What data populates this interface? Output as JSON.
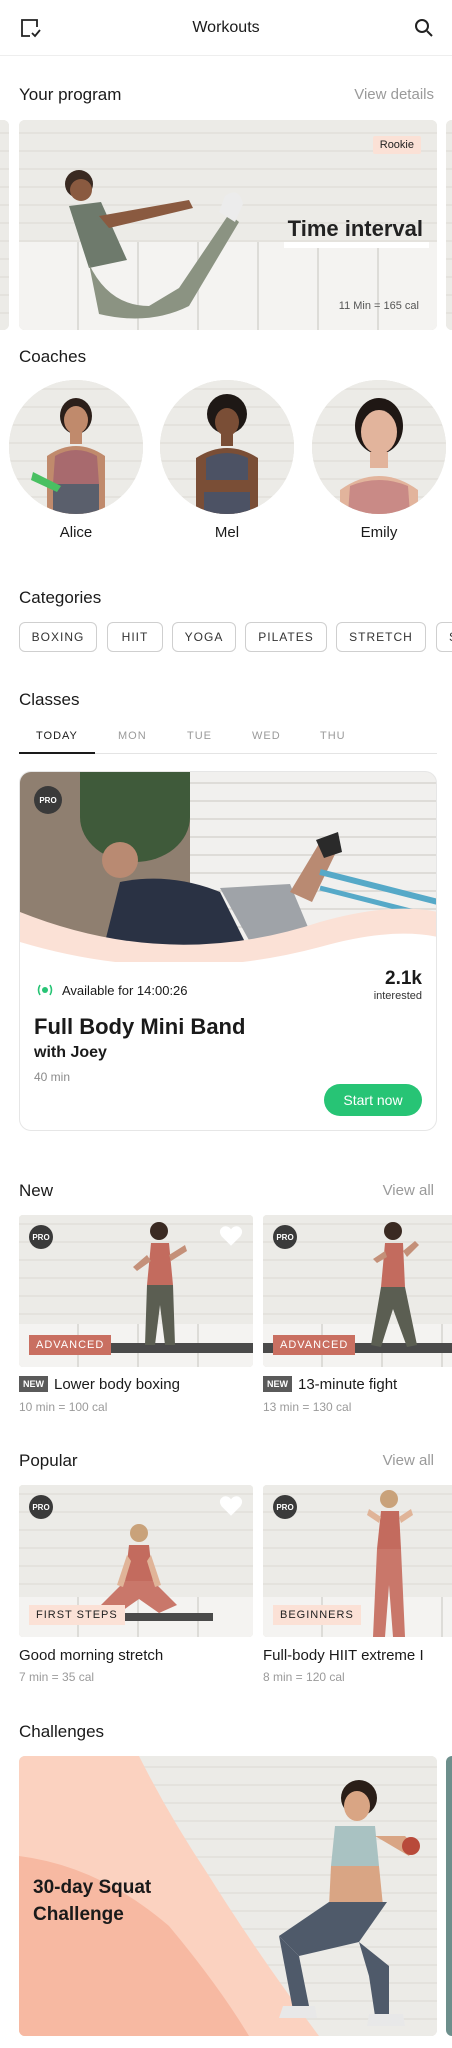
{
  "header": {
    "title": "Workouts"
  },
  "program": {
    "heading": "Your program",
    "view_details": "View details",
    "badge": "Rookie",
    "title": "Time interval",
    "meta": "11 Min = 165 cal"
  },
  "coaches": {
    "heading": "Coaches",
    "items": [
      {
        "name": "Alice"
      },
      {
        "name": "Mel"
      },
      {
        "name": "Emily"
      }
    ]
  },
  "categories": {
    "heading": "Categories",
    "items": [
      "BOXING",
      "HIIT",
      "YOGA",
      "PILATES",
      "STRETCH",
      "S"
    ]
  },
  "classes": {
    "heading": "Classes",
    "tabs": [
      "TODAY",
      "MON",
      "TUE",
      "WED",
      "THU"
    ],
    "active_tab": "TODAY",
    "card": {
      "pro": "PRO",
      "availability": "Available for 14:00:26",
      "count": "2.1k",
      "count_label": "interested",
      "title": "Full Body Mini Band",
      "coach": "with Joey",
      "duration": "40 min",
      "cta": "Start now"
    }
  },
  "new": {
    "heading": "New",
    "view_all": "View all",
    "items": [
      {
        "pro": "PRO",
        "level": "ADVANCED",
        "badge": "NEW",
        "title": "Lower body boxing",
        "meta": "10 min = 100 cal"
      },
      {
        "pro": "PRO",
        "level": "ADVANCED",
        "badge": "NEW",
        "title": "13-minute fight",
        "meta": "13 min = 130 cal"
      }
    ]
  },
  "popular": {
    "heading": "Popular",
    "view_all": "View all",
    "items": [
      {
        "pro": "PRO",
        "level": "FIRST STEPS",
        "title": "Good morning stretch",
        "meta": "7 min = 35 cal"
      },
      {
        "pro": "PRO",
        "level": "BEGINNERS",
        "title": "Full-body HIIT extreme I",
        "meta": "8 min = 120 cal"
      }
    ]
  },
  "challenges": {
    "heading": "Challenges",
    "title_line1": "30-day Squat",
    "title_line2": "Challenge"
  },
  "colors": {
    "accent": "#27c475",
    "peach": "#fbe1d6",
    "advanced": "#c96f61"
  }
}
